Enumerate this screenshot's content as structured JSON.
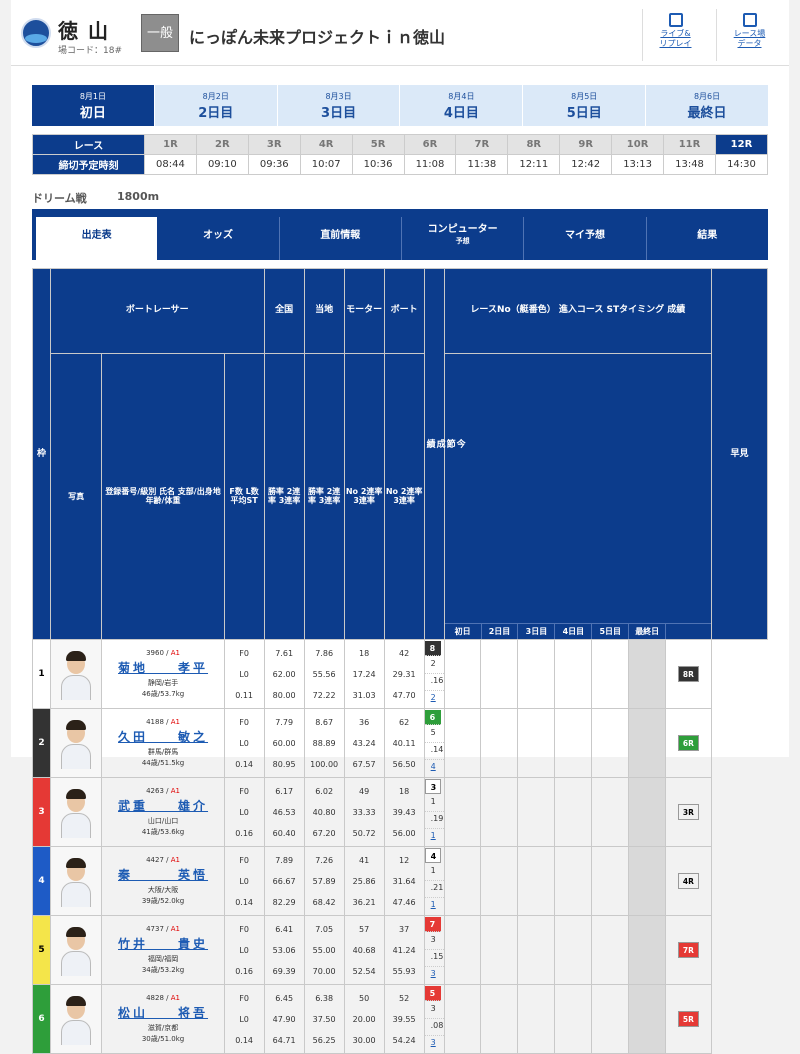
{
  "header": {
    "venue": "徳山",
    "venue_code": "場コード：18#",
    "grade": "一般",
    "race_title": "にっぽん未来プロジェクトｉｎ徳山",
    "buttons": [
      {
        "label1": "ライブ&",
        "label2": "リプレイ"
      },
      {
        "label1": "レース場",
        "label2": "データ"
      }
    ]
  },
  "days": [
    {
      "date": "8月1日",
      "name": "初日",
      "active": true
    },
    {
      "date": "8月2日",
      "name": "2日目"
    },
    {
      "date": "8月3日",
      "name": "3日目"
    },
    {
      "date": "8月4日",
      "name": "4日目"
    },
    {
      "date": "8月5日",
      "name": "5日目"
    },
    {
      "date": "8月6日",
      "name": "最終日"
    }
  ],
  "race_table": {
    "race_label": "レース",
    "time_label": "締切予定時刻",
    "races": [
      "1R",
      "2R",
      "3R",
      "4R",
      "5R",
      "6R",
      "7R",
      "8R",
      "9R",
      "10R",
      "11R",
      "12R"
    ],
    "times": [
      "08:44",
      "09:10",
      "09:36",
      "10:07",
      "10:36",
      "11:08",
      "11:38",
      "12:11",
      "12:42",
      "13:13",
      "13:48",
      "14:30"
    ],
    "current": "12R"
  },
  "race_info": {
    "name": "ドリーム戦",
    "distance": "1800m"
  },
  "tabs": [
    {
      "label": "出走表",
      "active": true
    },
    {
      "label": "オッズ"
    },
    {
      "label": "直前情報"
    },
    {
      "label": "コンピューター",
      "sub": "予想"
    },
    {
      "label": "マイ予想"
    },
    {
      "label": "結果"
    }
  ],
  "table_headers": {
    "frame": "枠",
    "boat_racer": "ボートレーサー",
    "photo": "写真",
    "info": "登録番号/級別 氏名 支部/出身地 年齢/体重",
    "fl": "F数 L数 平均ST",
    "zenkoku": "全国",
    "tochi": "当地",
    "motor": "モーター",
    "boat": "ボート",
    "rate_sub": "勝率 2連率 3連率",
    "no_sub": "No 2連率 3連率",
    "series_title": "レースNo（艇番色） 進入コース STタイミング 成績",
    "series_days": [
      "初日",
      "2日目",
      "3日目",
      "4日目",
      "5日目",
      "最終日"
    ],
    "konsetsu": "今節成績",
    "early": "早見"
  },
  "colors": {
    "frames": [
      "#ffffff",
      "#333333",
      "#e53935",
      "#1e5bc6",
      "#f4e54a",
      "#2e9e3a"
    ],
    "frame_text": [
      "#000000",
      "#ffffff",
      "#ffffff",
      "#ffffff",
      "#000000",
      "#ffffff"
    ]
  },
  "entries": [
    {
      "frame": "1",
      "reg": "3960",
      "cls": "A1",
      "name": "菊地　　孝平",
      "branch": "静岡/岩手",
      "age_weight": "46歳/53.7kg",
      "f": "F0",
      "l": "L0",
      "st": "0.11",
      "zen": [
        "7.61",
        "62.00",
        "80.00"
      ],
      "toc": [
        "7.86",
        "55.56",
        "72.22"
      ],
      "motor": [
        "18",
        "17.24",
        "31.03"
      ],
      "boat": [
        "42",
        "29.31",
        "47.70"
      ],
      "prev": {
        "race": "8",
        "course": "2",
        "st": ".16",
        "result": "2",
        "color": "#333333"
      },
      "early": "8R",
      "early_color": "#333333"
    },
    {
      "frame": "2",
      "reg": "4188",
      "cls": "A1",
      "name": "久田　　敏之",
      "branch": "群馬/群馬",
      "age_weight": "44歳/51.5kg",
      "f": "F0",
      "l": "L0",
      "st": "0.14",
      "zen": [
        "7.79",
        "60.00",
        "80.95"
      ],
      "toc": [
        "8.67",
        "88.89",
        "100.00"
      ],
      "motor": [
        "36",
        "43.24",
        "67.57"
      ],
      "boat": [
        "62",
        "40.11",
        "56.50"
      ],
      "prev": {
        "race": "6",
        "course": "5",
        "st": ".14",
        "result": "4",
        "color": "#2e9e3a"
      },
      "early": "6R",
      "early_color": "#2e9e3a"
    },
    {
      "frame": "3",
      "reg": "4263",
      "cls": "A1",
      "name": "武重　　雄介",
      "branch": "山口/山口",
      "age_weight": "41歳/53.6kg",
      "f": "F0",
      "l": "L0",
      "st": "0.16",
      "zen": [
        "6.17",
        "46.53",
        "60.40"
      ],
      "toc": [
        "6.02",
        "40.80",
        "67.20"
      ],
      "motor": [
        "49",
        "33.33",
        "50.72"
      ],
      "boat": [
        "18",
        "39.43",
        "56.00"
      ],
      "prev": {
        "race": "3",
        "course": "1",
        "st": ".19",
        "result": "1",
        "color": "#ffffff"
      },
      "early": "3R",
      "early_color": "#ffffff"
    },
    {
      "frame": "4",
      "reg": "4427",
      "cls": "A1",
      "name": "秦　　　英悟",
      "branch": "大阪/大阪",
      "age_weight": "39歳/52.0kg",
      "f": "F0",
      "l": "L0",
      "st": "0.14",
      "zen": [
        "7.89",
        "66.67",
        "82.29"
      ],
      "toc": [
        "7.26",
        "57.89",
        "68.42"
      ],
      "motor": [
        "41",
        "25.86",
        "36.21"
      ],
      "boat": [
        "12",
        "31.64",
        "47.46"
      ],
      "prev": {
        "race": "4",
        "course": "1",
        "st": ".21",
        "result": "1",
        "color": "#ffffff"
      },
      "early": "4R",
      "early_color": "#ffffff"
    },
    {
      "frame": "5",
      "reg": "4737",
      "cls": "A1",
      "name": "竹井　　貴史",
      "branch": "福岡/福岡",
      "age_weight": "34歳/53.2kg",
      "f": "F0",
      "l": "L0",
      "st": "0.16",
      "zen": [
        "6.41",
        "53.06",
        "69.39"
      ],
      "toc": [
        "7.05",
        "55.00",
        "70.00"
      ],
      "motor": [
        "57",
        "40.68",
        "52.54"
      ],
      "boat": [
        "37",
        "41.24",
        "55.93"
      ],
      "prev": {
        "race": "7",
        "course": "3",
        "st": ".15",
        "result": "3",
        "color": "#e53935"
      },
      "early": "7R",
      "early_color": "#e53935"
    },
    {
      "frame": "6",
      "reg": "4828",
      "cls": "A1",
      "name": "松山　　将吾",
      "branch": "滋賀/京都",
      "age_weight": "30歳/51.0kg",
      "f": "F0",
      "l": "L0",
      "st": "0.14",
      "zen": [
        "6.45",
        "47.90",
        "64.71"
      ],
      "toc": [
        "6.38",
        "37.50",
        "56.25"
      ],
      "motor": [
        "50",
        "20.00",
        "30.00"
      ],
      "boat": [
        "52",
        "39.55",
        "54.24"
      ],
      "prev": {
        "race": "5",
        "course": "3",
        "st": ".08",
        "result": "3",
        "color": "#e53935"
      },
      "early": "5R",
      "early_color": "#e53935"
    }
  ]
}
